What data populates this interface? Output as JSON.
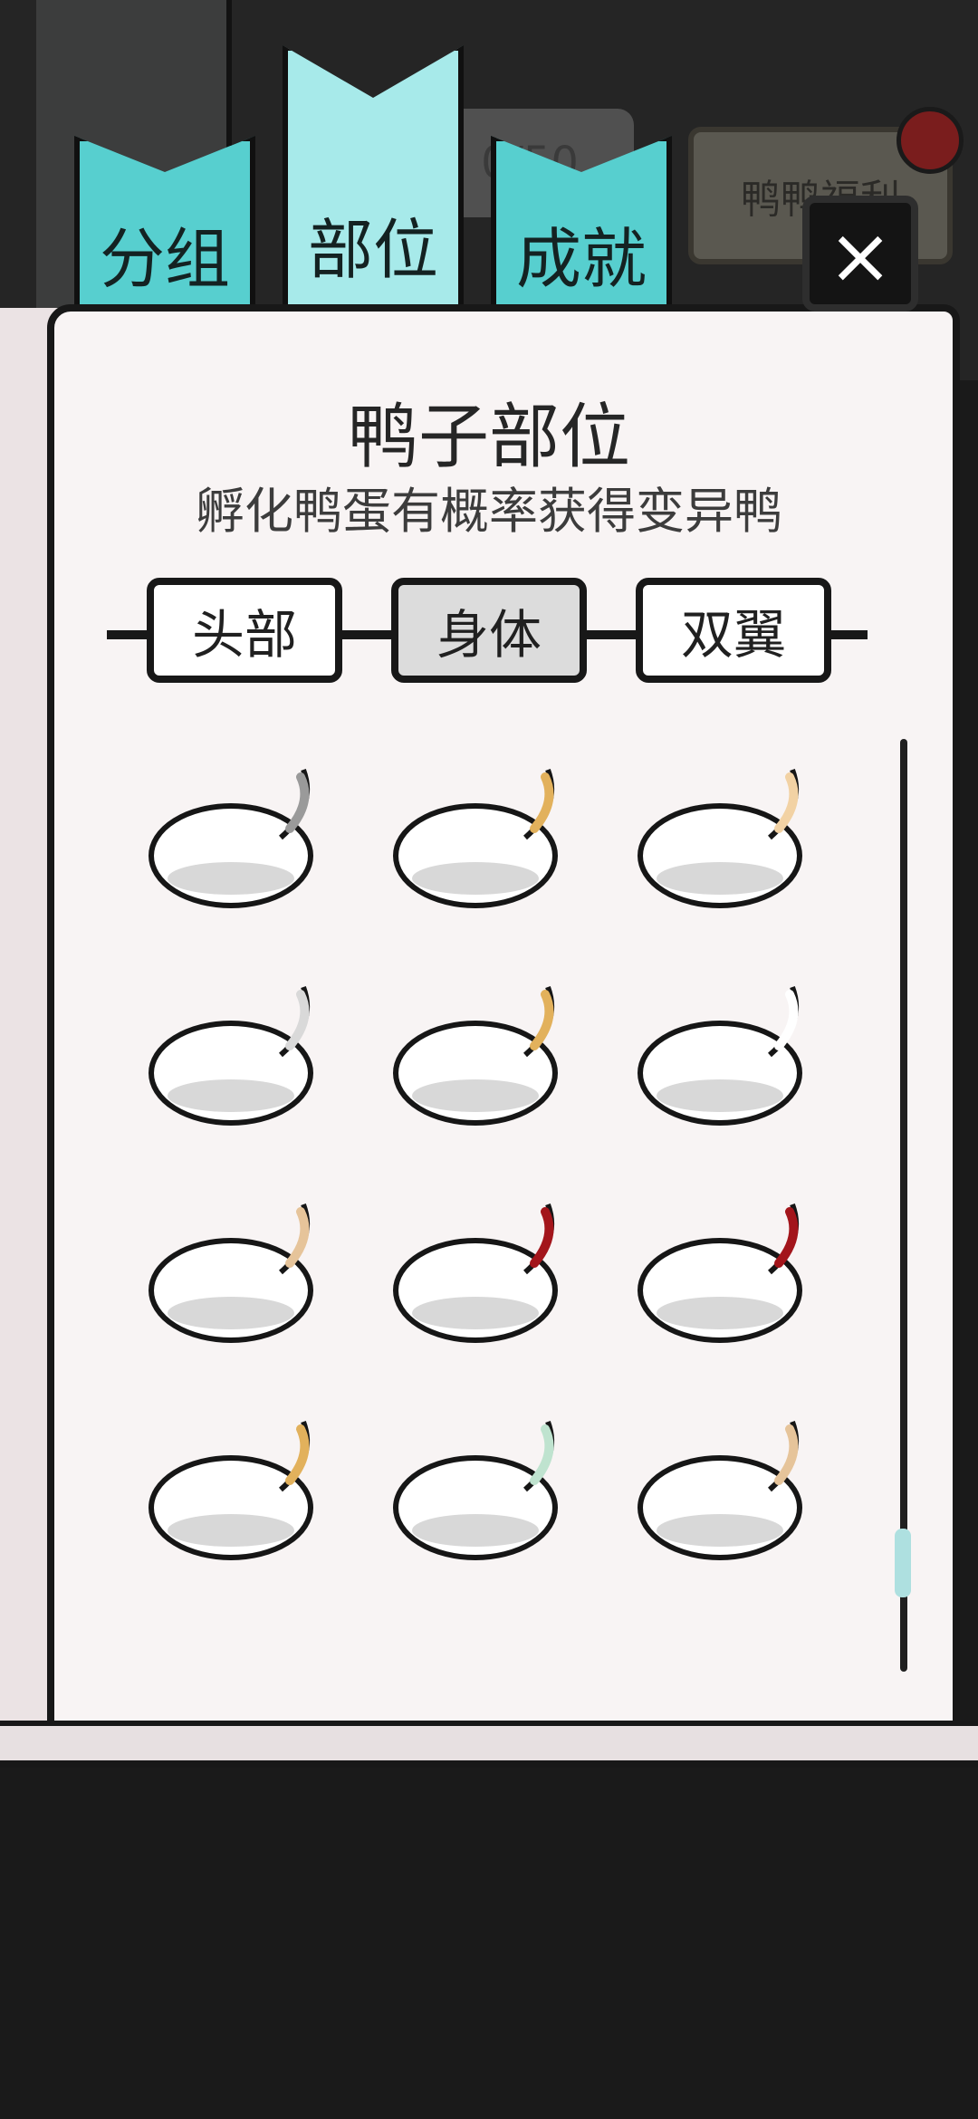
{
  "background": {
    "score_text": "0/50",
    "bonus_text": "鸭鸭福利"
  },
  "tabs": [
    {
      "label": "分组",
      "active": false
    },
    {
      "label": "部位",
      "active": true
    },
    {
      "label": "成就",
      "active": false
    }
  ],
  "close_label": "×",
  "panel": {
    "title": "鸭子部位",
    "subtitle": "孵化鸭蛋有概率获得变异鸭"
  },
  "categories": [
    {
      "label": "头部",
      "selected": false
    },
    {
      "label": "身体",
      "selected": true
    },
    {
      "label": "双翼",
      "selected": false
    }
  ],
  "parts": [
    {
      "icon": "zombie-duck-body-icon"
    },
    {
      "icon": "plain-duck-body-icon"
    },
    {
      "icon": "curled-tail-body-icon"
    },
    {
      "icon": "pixel-duck-body-icon"
    },
    {
      "icon": "sitting-duck-body-icon"
    },
    {
      "icon": "round-duck-body-icon"
    },
    {
      "icon": "spotted-tail-body-icon"
    },
    {
      "icon": "samurai-duck-body-icon"
    },
    {
      "icon": "striped-scarf-body-icon"
    },
    {
      "icon": "scarf-duck-body-icon"
    },
    {
      "icon": "balloon-duck-body-icon"
    },
    {
      "icon": "feather-tail-body-icon"
    }
  ],
  "colors": {
    "tab": "#57cfcf",
    "tab_active": "#a7eaea",
    "page": "#f8f4f4",
    "outline": "#181818"
  }
}
